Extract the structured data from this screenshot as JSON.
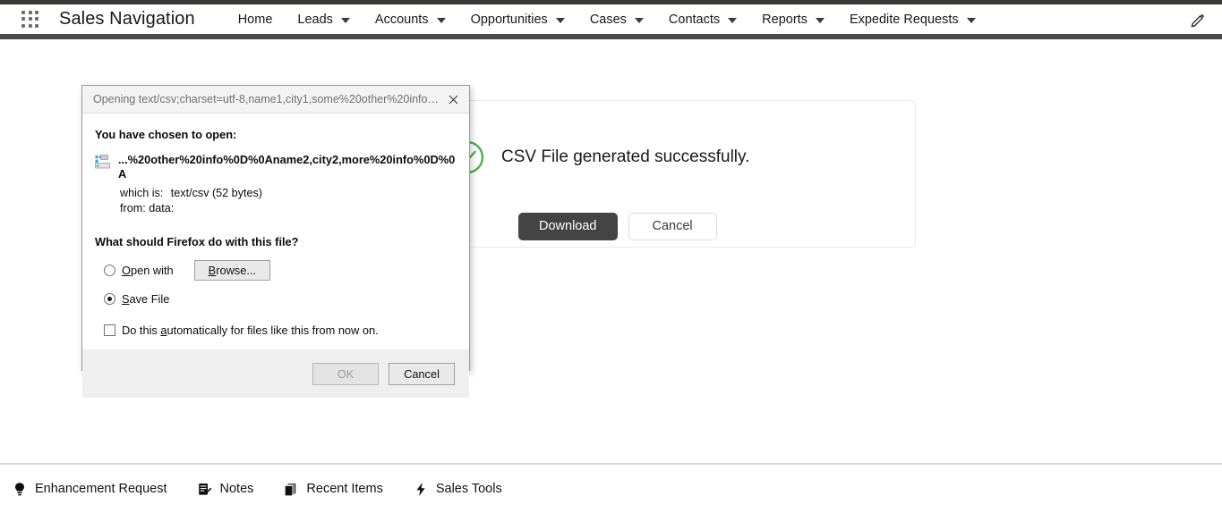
{
  "nav": {
    "app_launcher_icon": "app-launcher-grid-icon",
    "brand": "Sales Navigation",
    "items": [
      {
        "label": "Home",
        "has_caret": false
      },
      {
        "label": "Leads",
        "has_caret": true
      },
      {
        "label": "Accounts",
        "has_caret": true
      },
      {
        "label": "Opportunities",
        "has_caret": true
      },
      {
        "label": "Cases",
        "has_caret": true
      },
      {
        "label": "Contacts",
        "has_caret": true
      },
      {
        "label": "Reports",
        "has_caret": true
      },
      {
        "label": "Expedite Requests",
        "has_caret": true
      }
    ],
    "edit_icon": "pencil-icon"
  },
  "main": {
    "success_icon": "check-circle-icon",
    "success_color": "#4bae4f",
    "message": "CSV File generated successfully.",
    "download_label": "Download",
    "cancel_label": "Cancel",
    "download_bg": "#444444"
  },
  "dialog": {
    "title": "Opening text/csv;charset=utf-8,name1,city1,some%20other%20info%0D...",
    "close_icon": "close-icon",
    "chosen_label": "You have chosen to open:",
    "file_icon": "file-type-icon",
    "file_name": "...%20other%20info%0D%0Aname2,city2,more%20info%0D%0A",
    "which_is_key": "which is:",
    "which_is_value": "text/csv (52 bytes)",
    "from_key": "from:",
    "from_value": "data:",
    "question": "What should Firefox do with this file?",
    "open_with_label": "Open with",
    "open_with_accel": "O",
    "browse_label": "Browse...",
    "browse_accel": "B",
    "save_file_label": "Save File",
    "save_file_accel": "S",
    "auto_label": "Do this automatically for files like this from now on.",
    "auto_accel": "a",
    "selected_option": "save_file",
    "auto_checked": false,
    "ok_label": "OK",
    "ok_disabled": true,
    "cancel_label": "Cancel"
  },
  "footer": {
    "items": [
      {
        "label": "Enhancement Request",
        "icon": "lightbulb-icon"
      },
      {
        "label": "Notes",
        "icon": "notes-icon"
      },
      {
        "label": "Recent Items",
        "icon": "recent-items-icon"
      },
      {
        "label": "Sales Tools",
        "icon": "lightning-bolt-icon"
      }
    ]
  }
}
